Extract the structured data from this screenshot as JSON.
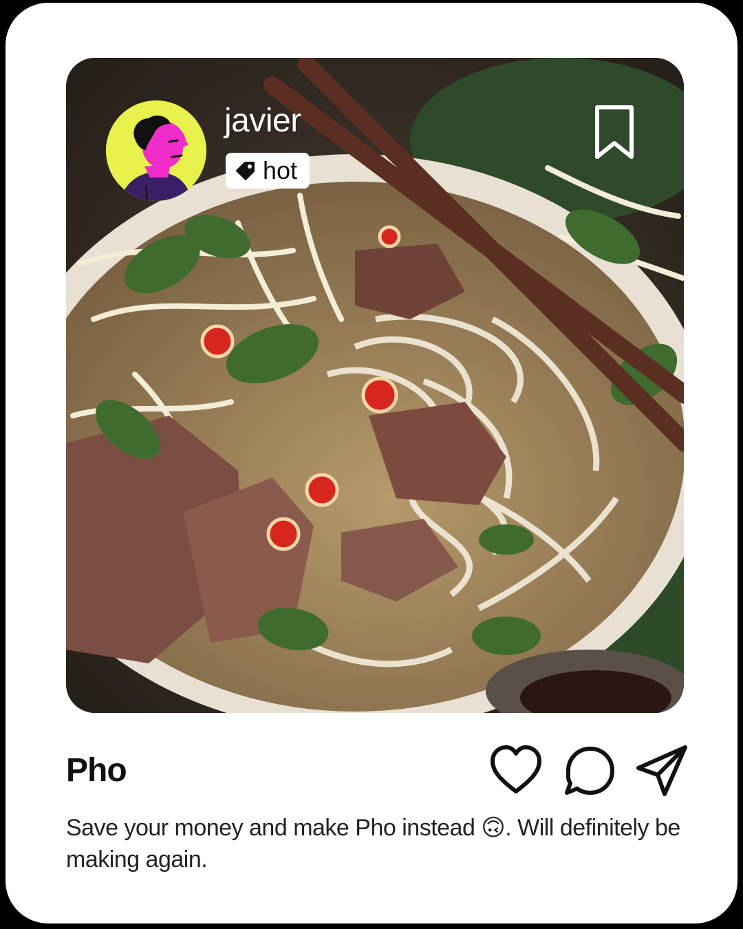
{
  "post": {
    "username": "javier",
    "tag": {
      "label": "hot",
      "icon": "tag-icon"
    },
    "bookmark_icon": "bookmark-icon",
    "title": "Pho",
    "caption": "Save your money and make Pho instead 🙃. Will definitely be making again.",
    "actions": [
      {
        "name": "like",
        "icon": "heart-icon"
      },
      {
        "name": "comment",
        "icon": "comment-icon"
      },
      {
        "name": "share",
        "icon": "send-icon"
      }
    ]
  },
  "colors": {
    "card_background": "#ffffff",
    "avatar_background": "#e9f14d",
    "avatar_face": "#f02dc8",
    "text_primary": "#111111"
  }
}
